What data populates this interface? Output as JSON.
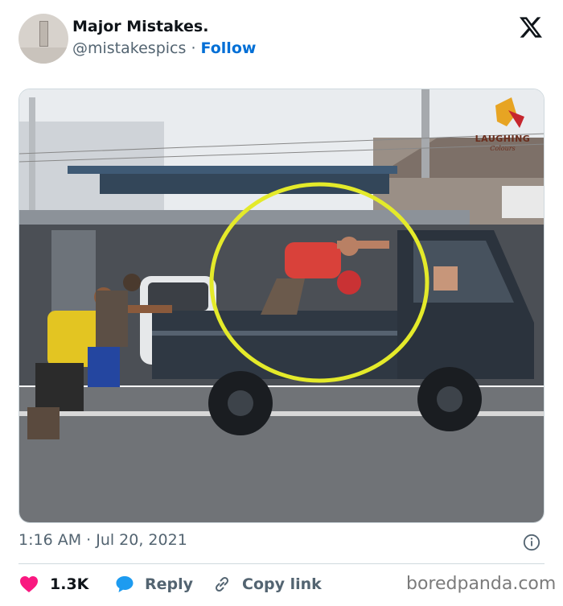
{
  "header": {
    "name": "Major Mistakes.",
    "handle": "@mistakespics",
    "separator": "·",
    "follow_label": "Follow"
  },
  "photo": {
    "logo_text": "LAUGHING",
    "logo_subtext": "Colours"
  },
  "meta": {
    "timestamp": "1:16 AM · Jul 20, 2021"
  },
  "actions": {
    "like_count": "1.3K",
    "reply_label": "Reply",
    "copy_link_label": "Copy link"
  },
  "watermark": "boredpanda.com",
  "colors": {
    "accent": "#006fd6",
    "like": "#f91880",
    "reply": "#1d9bf0",
    "highlight_circle": "#e4ea2a"
  },
  "icons": {
    "platform": "x-logo-icon",
    "info": "info-icon",
    "like": "heart-icon",
    "reply": "speech-bubble-icon",
    "copy": "link-icon"
  }
}
